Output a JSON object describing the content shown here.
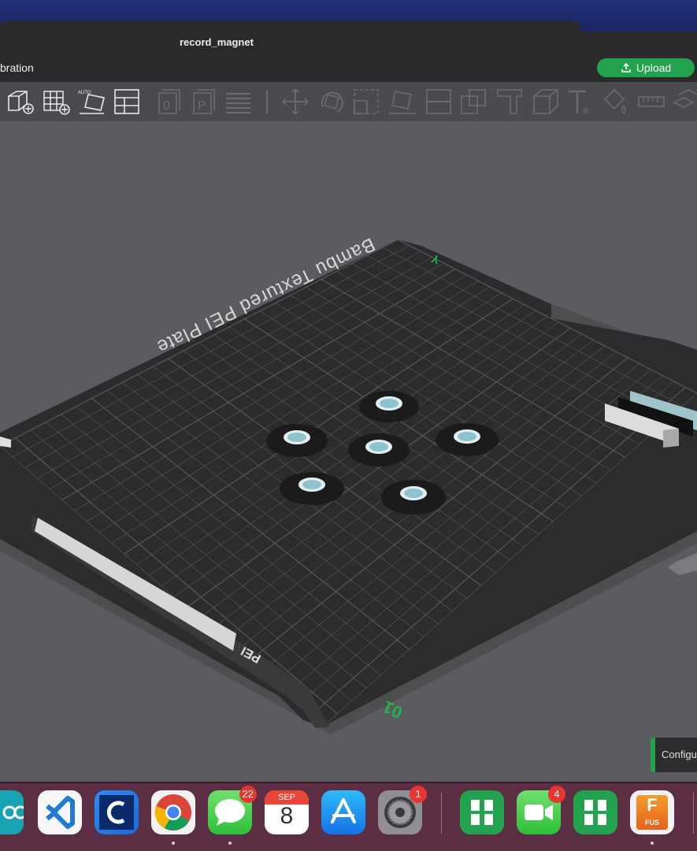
{
  "window": {
    "title": "record_magnet"
  },
  "menubar": {
    "tab_label": "bration",
    "upload_label": "Upload"
  },
  "toolbar": {
    "items": [
      "add-object-icon",
      "add-plate-icon",
      "auto-orient-icon",
      "arrange-icon",
      "layer-0-icon",
      "layer-p-icon",
      "lines-icon",
      "move-icon",
      "rotate-icon",
      "scale-icon",
      "lay-on-face-icon",
      "split-icon",
      "cut-icon",
      "support-icon",
      "cube-icon",
      "text-icon",
      "paint-icon",
      "measure-icon",
      "assembly-icon"
    ]
  },
  "plate": {
    "label": "Bambu Textured PEI Plate",
    "y_axis_label": "Y",
    "corner_label": "01",
    "plate_tag": "PEI"
  },
  "side_panel": {
    "label": "Configu"
  },
  "dock": {
    "apps": [
      {
        "name": "arduino",
        "badge": ""
      },
      {
        "name": "vscode",
        "badge": ""
      },
      {
        "name": "clion",
        "badge": ""
      },
      {
        "name": "chrome",
        "badge": ""
      },
      {
        "name": "messages",
        "badge": "22"
      },
      {
        "name": "calendar",
        "badge": "",
        "month": "SEP",
        "day": "8"
      },
      {
        "name": "app-store",
        "badge": ""
      },
      {
        "name": "system-settings",
        "badge": "1"
      },
      {
        "name": "bambu-studio",
        "badge": ""
      },
      {
        "name": "facetime",
        "badge": "4"
      },
      {
        "name": "bambu-studio-2",
        "badge": ""
      },
      {
        "name": "fusion",
        "badge": "",
        "label": "F",
        "sublabel": "FUS"
      }
    ]
  },
  "colors": {
    "accent": "#23a24d",
    "badge": "#e8352f",
    "plate": "#2c2c2e",
    "grid": "#555558"
  }
}
